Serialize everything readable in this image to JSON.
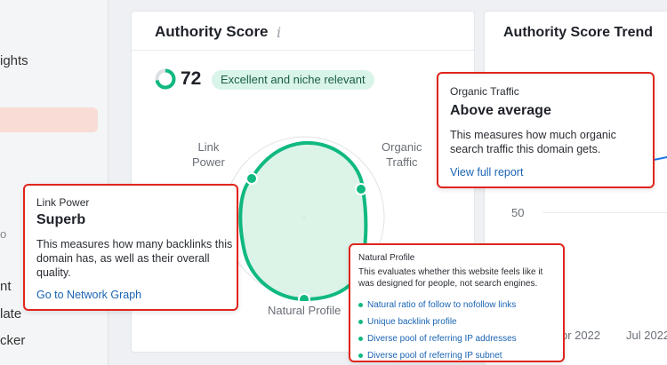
{
  "sidebar": {
    "items": [
      "ights",
      "o",
      "nt",
      "late",
      "cker"
    ]
  },
  "card": {
    "title": "Authority Score",
    "info_icon": "info-icon",
    "score": "72",
    "badge": "Excellent and niche relevant",
    "score_fraction": 0.72,
    "accent": "#10b981",
    "radar": {
      "labels": {
        "link_power": [
          "Link",
          "Power"
        ],
        "organic_traffic": [
          "Organic",
          "Traffic"
        ],
        "natural_profile": "Natural Profile"
      }
    }
  },
  "trend": {
    "title": "Authority Score Trend",
    "y_tick": "50",
    "x_ticks": [
      "pr 2022",
      "Jul 2022"
    ]
  },
  "popovers": {
    "organic_traffic": {
      "label": "Organic Traffic",
      "headline": "Above average",
      "body": "This measures how much organic search traffic this domain gets.",
      "link": "View full report"
    },
    "link_power": {
      "label": "Link Power",
      "headline": "Superb",
      "body": "This measures how many backlinks this domain has, as well as their overall quality.",
      "link": "Go to Network Graph"
    },
    "natural_profile": {
      "label": "Natural Profile",
      "body": "This evaluates whether this website feels like it was designed for people, not search engines.",
      "items": [
        "Natural ratio of follow to nofollow links",
        "Unique backlink profile",
        "Diverse pool of referring IP addresses",
        "Diverse pool of referring IP subnet"
      ]
    }
  },
  "colors": {
    "highlight_border": "#e0251b",
    "link": "#1a64b4"
  }
}
